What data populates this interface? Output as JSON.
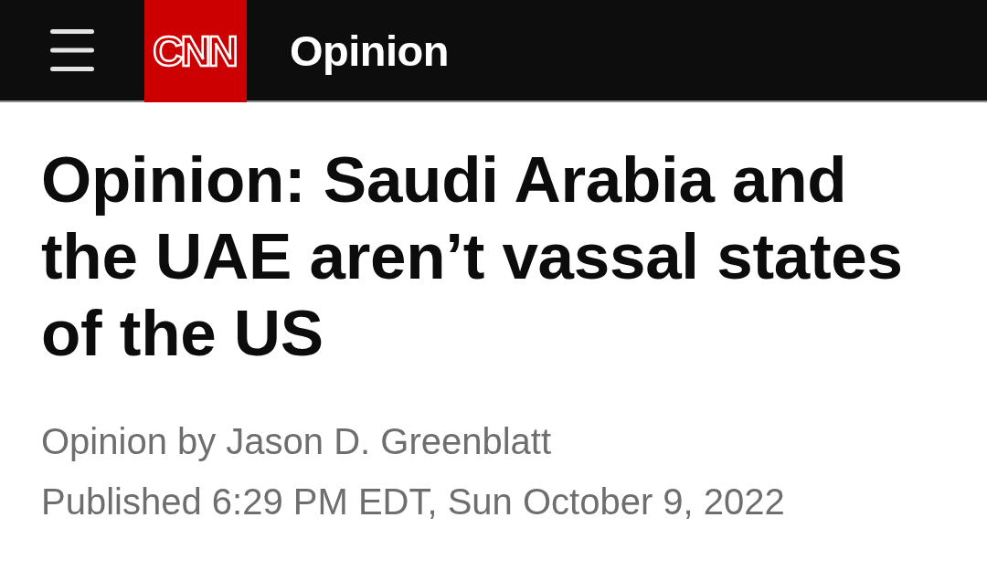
{
  "header": {
    "logo": "CNN",
    "section": "Opinion"
  },
  "article": {
    "headline": "Opinion: Saudi Arabia and the UAE aren’t vassal states of the US",
    "byline": "Opinion by Jason D. Greenblatt",
    "published": "Published 6:29 PM EDT, Sun October 9, 2022"
  }
}
